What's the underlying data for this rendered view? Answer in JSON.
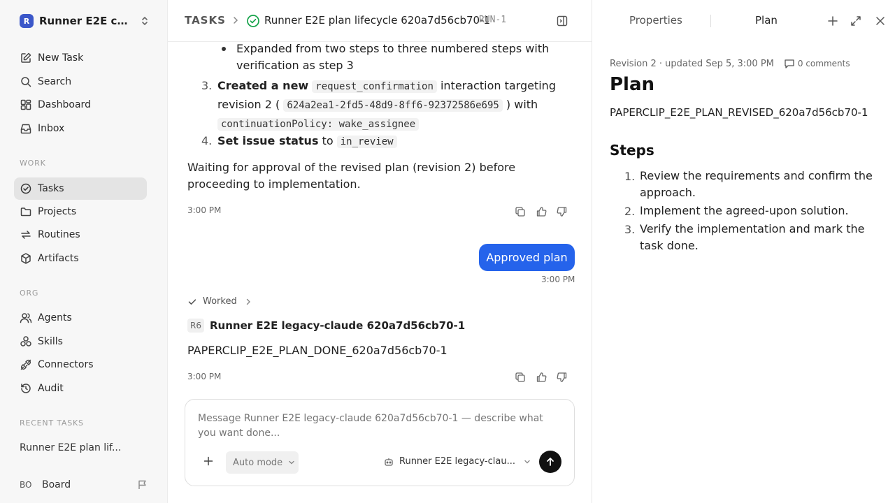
{
  "workspace": {
    "logo_letter": "R",
    "name": "Runner E2E co..."
  },
  "sidebar": {
    "primary": [
      {
        "label": "New Task"
      },
      {
        "label": "Search"
      },
      {
        "label": "Dashboard"
      },
      {
        "label": "Inbox"
      }
    ],
    "work_section": "WORK",
    "work": [
      {
        "label": "Tasks"
      },
      {
        "label": "Projects"
      },
      {
        "label": "Routines"
      },
      {
        "label": "Artifacts"
      }
    ],
    "org_section": "ORG",
    "org": [
      {
        "label": "Agents"
      },
      {
        "label": "Skills"
      },
      {
        "label": "Connectors"
      },
      {
        "label": "Audit"
      }
    ],
    "recent_section": "RECENT TASKS",
    "recent_task": "Runner E2E plan lif...",
    "user_initials": "BO",
    "user_name": "Board"
  },
  "breadcrumb": {
    "tasks": "TASKS",
    "title": "Runner E2E plan lifecycle 620a7d56cb70-1",
    "run_id": "RUN-1"
  },
  "message1": {
    "bullet": "Expanded from two steps to three numbered steps with verification as step 3",
    "item3_num": "3.",
    "item3_bold": "Created a new",
    "item3_code1": "request_confirmation",
    "item3_mid": "interaction targeting revision 2 (",
    "item3_code2": "624a2ea1-2fd5-48d9-8ff6-92372586e695",
    "item3_after": ") with",
    "item3_code3": "continuationPolicy: wake_assignee",
    "item4_num": "4.",
    "item4_bold": "Set issue status",
    "item4_mid": "to",
    "item4_code": "in_review",
    "paragraph": "Waiting for approval of the revised plan (revision 2) before proceeding to implementation.",
    "time": "3:00 PM"
  },
  "user_message": {
    "text": "Approved plan",
    "time": "3:00 PM"
  },
  "worked_label": "Worked",
  "agent_message": {
    "avatar": "R6",
    "name": "Runner E2E legacy-claude 620a7d56cb70-1",
    "text": "PAPERCLIP_E2E_PLAN_DONE_620a7d56cb70-1",
    "time": "3:00 PM"
  },
  "composer": {
    "placeholder": "Message Runner E2E legacy-claude 620a7d56cb70-1 — describe what you want done...",
    "mode": "Auto mode",
    "agent": "Runner E2E legacy-clau..."
  },
  "panel": {
    "tab_properties": "Properties",
    "tab_plan": "Plan",
    "meta": "Revision 2 · updated Sep 5, 3:00 PM",
    "comments": "0 comments",
    "title": "Plan",
    "code": "PAPERCLIP_E2E_PLAN_REVISED_620a7d56cb70-1",
    "steps_heading": "Steps",
    "steps": [
      {
        "num": "1.",
        "text": "Review the requirements and confirm the approach."
      },
      {
        "num": "2.",
        "text": "Implement the agreed-upon solution."
      },
      {
        "num": "3.",
        "text": "Verify the implementation and mark the task done."
      }
    ]
  },
  "colors": {
    "accent": "#2563eb",
    "active_nav": "#e4e4e4",
    "success": "#16a34a",
    "logo": "#3b57c9"
  },
  "icons": [
    "edit-icon",
    "search-icon",
    "dashboard-icon",
    "inbox-icon",
    "tasks-icon",
    "folder-icon",
    "routines-icon",
    "box-icon",
    "agents-icon",
    "skills-icon",
    "plug-icon",
    "audit-icon",
    "flag-icon",
    "copy-icon",
    "thumbs-up-icon",
    "thumbs-down-icon",
    "check-icon",
    "chevron-right-icon",
    "plus-icon",
    "expand-icon",
    "close-icon",
    "comment-icon",
    "send-icon",
    "bot-icon"
  ]
}
